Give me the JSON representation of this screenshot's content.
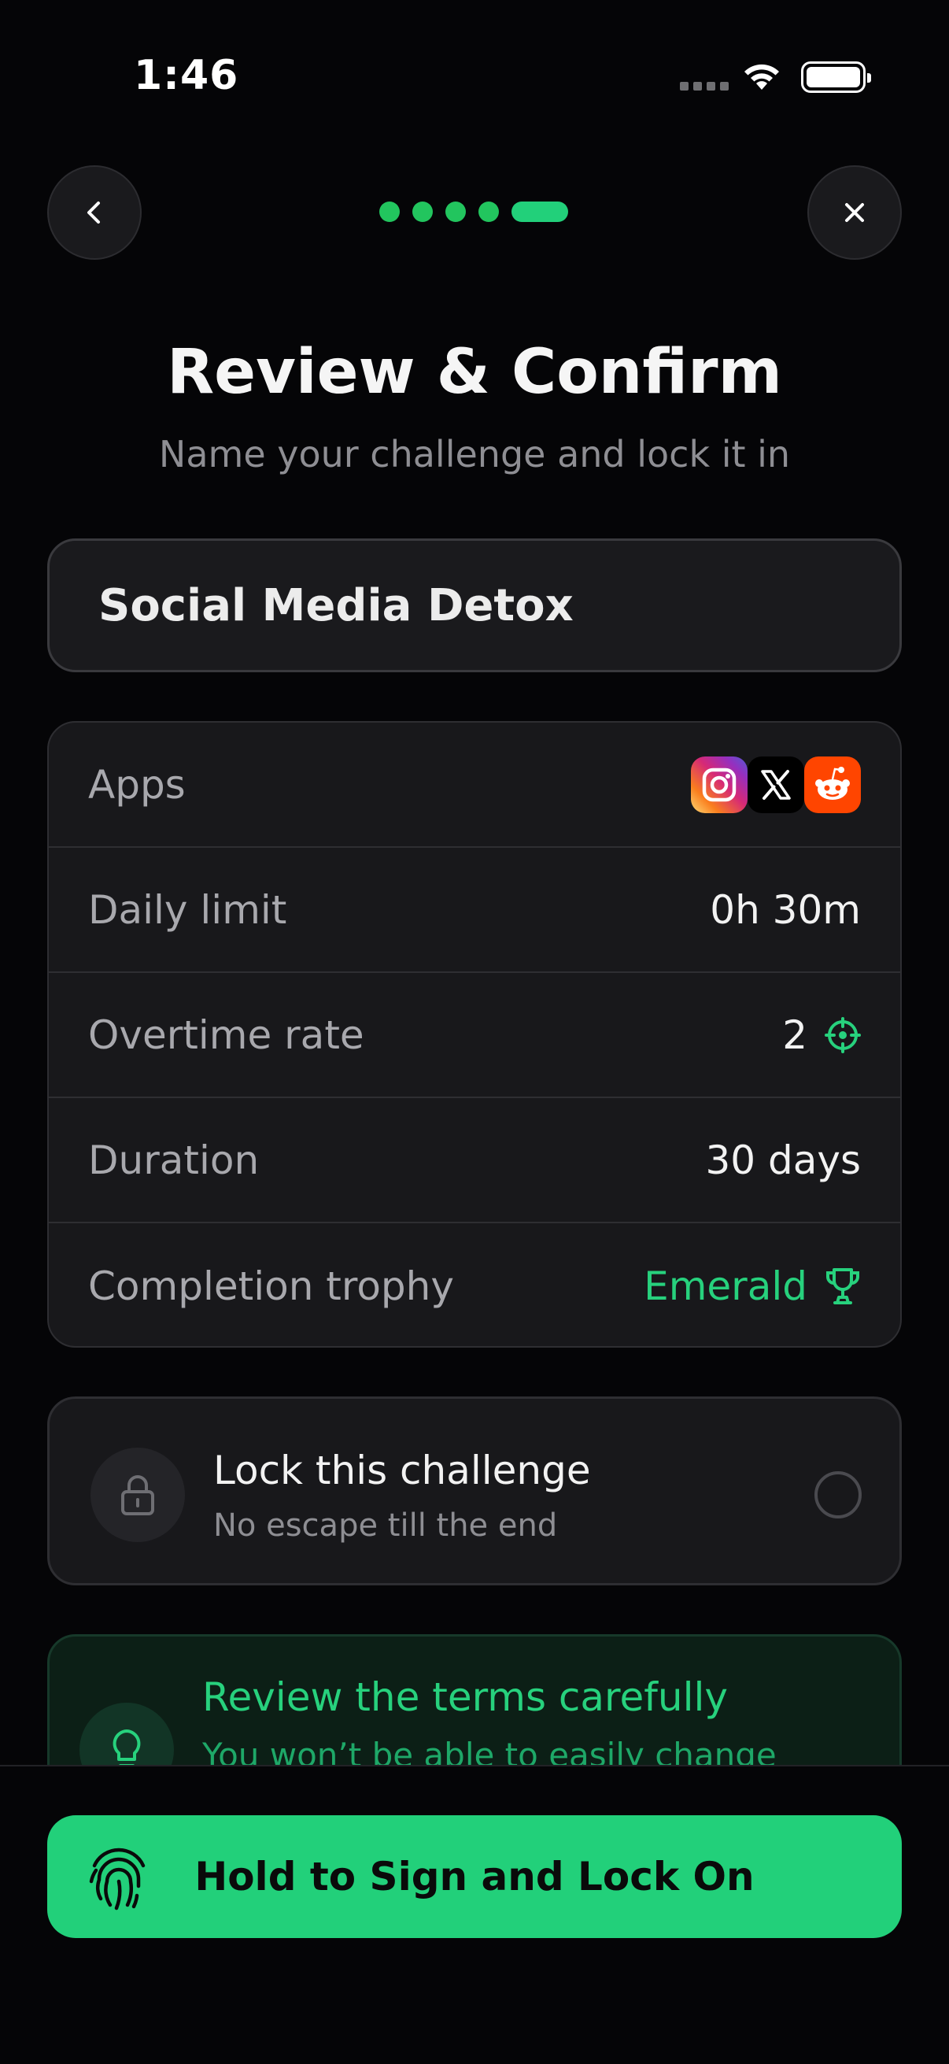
{
  "status_bar": {
    "time": "1:46"
  },
  "header": {
    "title": "Review & Confirm",
    "subtitle": "Name your challenge and lock it in",
    "progress_total": 5,
    "progress_current": 5
  },
  "challenge_name": "Social Media Detox",
  "summary": {
    "apps_label": "Apps",
    "apps": [
      "instagram-icon",
      "x-icon",
      "reddit-icon"
    ],
    "daily_limit_label": "Daily limit",
    "daily_limit_value": "0h 30m",
    "overtime_label": "Overtime rate",
    "overtime_value": "2",
    "duration_label": "Duration",
    "duration_value": "30 days",
    "trophy_label": "Completion trophy",
    "trophy_value": "Emerald"
  },
  "lock": {
    "title": "Lock this challenge",
    "subtitle": "No escape till the end",
    "checked": false
  },
  "tip": {
    "title": "Review the terms carefully",
    "body": "You won’t be able to easily change"
  },
  "action": {
    "label": "Hold to Sign and Lock On"
  },
  "colors": {
    "accent": "#22d07a",
    "background": "#050507",
    "card": "#18181b"
  }
}
